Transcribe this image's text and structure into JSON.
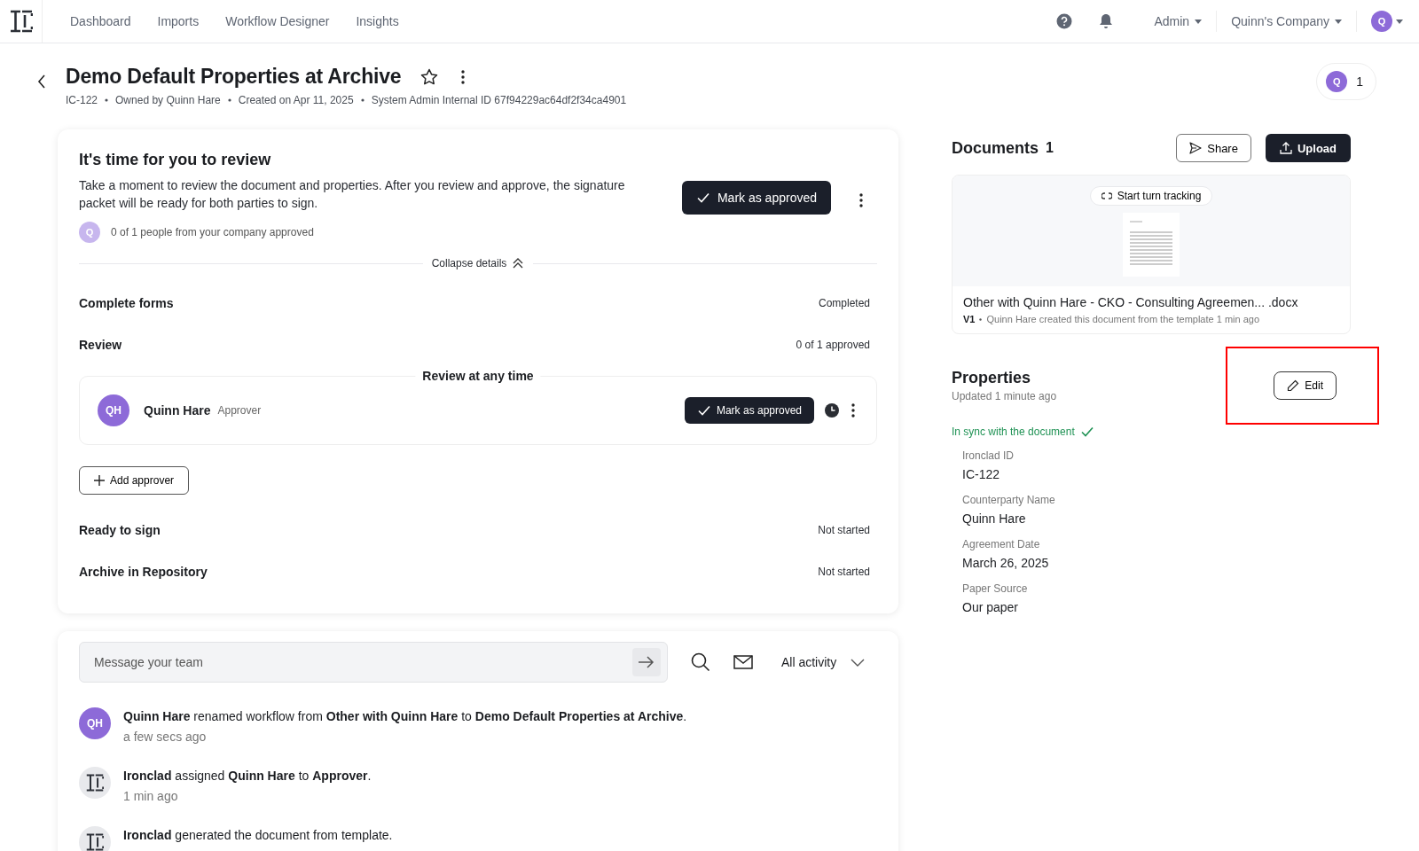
{
  "nav": {
    "links": [
      {
        "label": "Dashboard"
      },
      {
        "label": "Imports"
      },
      {
        "label": "Workflow Designer"
      },
      {
        "label": "Insights"
      }
    ],
    "menus": [
      {
        "label": "Admin"
      },
      {
        "label": "Quinn's Company"
      }
    ],
    "avatar": "Q"
  },
  "header": {
    "title": "Demo Default Properties at Archive",
    "meta": [
      "IC-122",
      "Owned by Quinn Hare",
      "Created on Apr 11, 2025",
      "System Admin Internal ID 67f94229ac64df2f34ca4901"
    ],
    "participants": {
      "avatar": "Q",
      "count": "1"
    }
  },
  "review": {
    "title": "It's time for you to review",
    "text": "Take a moment to review the document and properties. After you review and approve, the signature packet will be ready for both parties to sign.",
    "approve_button": "Mark as approved",
    "approvals": {
      "avatar": "Q",
      "text": "0 of 1 people from your company approved"
    },
    "collapse": "Collapse details",
    "steps": [
      {
        "kind": "status",
        "name": "Complete forms",
        "status": "Completed"
      },
      {
        "kind": "status",
        "name": "Review",
        "status": "0 of 1 approved"
      },
      {
        "kind": "approvers",
        "group": "Review at any time",
        "approvers": [
          {
            "initials": "QH",
            "name": "Quinn Hare",
            "role": "Approver",
            "button": "Mark as approved"
          }
        ],
        "add_button": "Add approver"
      },
      {
        "kind": "status",
        "name": "Ready to sign",
        "status": "Not started"
      },
      {
        "kind": "status",
        "name": "Archive in Repository",
        "status": "Not started"
      }
    ]
  },
  "activity": {
    "message_placeholder": "Message your team",
    "filter": "All activity",
    "events": [
      {
        "kind": "user",
        "initials": "QH",
        "text": "**Quinn Hare** renamed workflow from **Other with Quinn Hare** to **Demo Default Properties at Archive**.",
        "time": "a few secs ago"
      },
      {
        "kind": "system",
        "text": "**Ironclad** assigned **Quinn Hare** to **Approver**.",
        "time": "1 min ago"
      },
      {
        "kind": "system",
        "text": "**Ironclad** generated the document from template."
      }
    ]
  },
  "documents": {
    "title": "Documents",
    "count": "1",
    "share_button": "Share",
    "upload_button": "Upload",
    "items": [
      {
        "tracking_button": "Start turn tracking",
        "name": "Other with Quinn Hare - CKO - Consulting Agreemen... .docx",
        "version": "V1",
        "detail": "Quinn Hare created this document from the template 1 min ago"
      }
    ]
  },
  "properties": {
    "title": "Properties",
    "updated": "Updated 1 minute ago",
    "edit_button": {
      "label": "Edit",
      "highlighted": true
    },
    "sync": "In sync with the document",
    "fields": [
      {
        "label": "Ironclad ID",
        "value": "IC-122"
      },
      {
        "label": "Counterparty Name",
        "value": "Quinn Hare"
      },
      {
        "label": "Agreement Date",
        "value": "March 26, 2025"
      },
      {
        "label": "Paper Source",
        "value": "Our paper"
      }
    ]
  }
}
